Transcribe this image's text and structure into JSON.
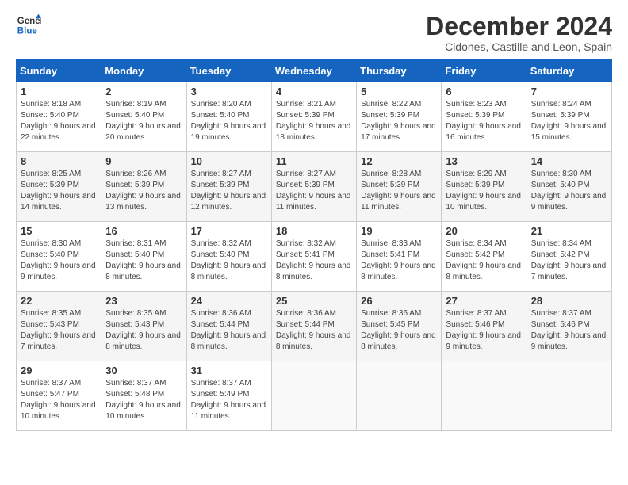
{
  "logo": {
    "line1": "General",
    "line2": "Blue"
  },
  "title": "December 2024",
  "subtitle": "Cidones, Castille and Leon, Spain",
  "weekdays": [
    "Sunday",
    "Monday",
    "Tuesday",
    "Wednesday",
    "Thursday",
    "Friday",
    "Saturday"
  ],
  "weeks": [
    [
      {
        "day": "1",
        "sunrise": "8:18 AM",
        "sunset": "5:40 PM",
        "daylight": "9 hours and 22 minutes."
      },
      {
        "day": "2",
        "sunrise": "8:19 AM",
        "sunset": "5:40 PM",
        "daylight": "9 hours and 20 minutes."
      },
      {
        "day": "3",
        "sunrise": "8:20 AM",
        "sunset": "5:40 PM",
        "daylight": "9 hours and 19 minutes."
      },
      {
        "day": "4",
        "sunrise": "8:21 AM",
        "sunset": "5:39 PM",
        "daylight": "9 hours and 18 minutes."
      },
      {
        "day": "5",
        "sunrise": "8:22 AM",
        "sunset": "5:39 PM",
        "daylight": "9 hours and 17 minutes."
      },
      {
        "day": "6",
        "sunrise": "8:23 AM",
        "sunset": "5:39 PM",
        "daylight": "9 hours and 16 minutes."
      },
      {
        "day": "7",
        "sunrise": "8:24 AM",
        "sunset": "5:39 PM",
        "daylight": "9 hours and 15 minutes."
      }
    ],
    [
      {
        "day": "8",
        "sunrise": "8:25 AM",
        "sunset": "5:39 PM",
        "daylight": "9 hours and 14 minutes."
      },
      {
        "day": "9",
        "sunrise": "8:26 AM",
        "sunset": "5:39 PM",
        "daylight": "9 hours and 13 minutes."
      },
      {
        "day": "10",
        "sunrise": "8:27 AM",
        "sunset": "5:39 PM",
        "daylight": "9 hours and 12 minutes."
      },
      {
        "day": "11",
        "sunrise": "8:27 AM",
        "sunset": "5:39 PM",
        "daylight": "9 hours and 11 minutes."
      },
      {
        "day": "12",
        "sunrise": "8:28 AM",
        "sunset": "5:39 PM",
        "daylight": "9 hours and 11 minutes."
      },
      {
        "day": "13",
        "sunrise": "8:29 AM",
        "sunset": "5:39 PM",
        "daylight": "9 hours and 10 minutes."
      },
      {
        "day": "14",
        "sunrise": "8:30 AM",
        "sunset": "5:40 PM",
        "daylight": "9 hours and 9 minutes."
      }
    ],
    [
      {
        "day": "15",
        "sunrise": "8:30 AM",
        "sunset": "5:40 PM",
        "daylight": "9 hours and 9 minutes."
      },
      {
        "day": "16",
        "sunrise": "8:31 AM",
        "sunset": "5:40 PM",
        "daylight": "9 hours and 8 minutes."
      },
      {
        "day": "17",
        "sunrise": "8:32 AM",
        "sunset": "5:40 PM",
        "daylight": "9 hours and 8 minutes."
      },
      {
        "day": "18",
        "sunrise": "8:32 AM",
        "sunset": "5:41 PM",
        "daylight": "9 hours and 8 minutes."
      },
      {
        "day": "19",
        "sunrise": "8:33 AM",
        "sunset": "5:41 PM",
        "daylight": "9 hours and 8 minutes."
      },
      {
        "day": "20",
        "sunrise": "8:34 AM",
        "sunset": "5:42 PM",
        "daylight": "9 hours and 8 minutes."
      },
      {
        "day": "21",
        "sunrise": "8:34 AM",
        "sunset": "5:42 PM",
        "daylight": "9 hours and 7 minutes."
      }
    ],
    [
      {
        "day": "22",
        "sunrise": "8:35 AM",
        "sunset": "5:43 PM",
        "daylight": "9 hours and 7 minutes."
      },
      {
        "day": "23",
        "sunrise": "8:35 AM",
        "sunset": "5:43 PM",
        "daylight": "9 hours and 8 minutes."
      },
      {
        "day": "24",
        "sunrise": "8:36 AM",
        "sunset": "5:44 PM",
        "daylight": "9 hours and 8 minutes."
      },
      {
        "day": "25",
        "sunrise": "8:36 AM",
        "sunset": "5:44 PM",
        "daylight": "9 hours and 8 minutes."
      },
      {
        "day": "26",
        "sunrise": "8:36 AM",
        "sunset": "5:45 PM",
        "daylight": "9 hours and 8 minutes."
      },
      {
        "day": "27",
        "sunrise": "8:37 AM",
        "sunset": "5:46 PM",
        "daylight": "9 hours and 9 minutes."
      },
      {
        "day": "28",
        "sunrise": "8:37 AM",
        "sunset": "5:46 PM",
        "daylight": "9 hours and 9 minutes."
      }
    ],
    [
      {
        "day": "29",
        "sunrise": "8:37 AM",
        "sunset": "5:47 PM",
        "daylight": "9 hours and 10 minutes."
      },
      {
        "day": "30",
        "sunrise": "8:37 AM",
        "sunset": "5:48 PM",
        "daylight": "9 hours and 10 minutes."
      },
      {
        "day": "31",
        "sunrise": "8:37 AM",
        "sunset": "5:49 PM",
        "daylight": "9 hours and 11 minutes."
      },
      null,
      null,
      null,
      null
    ]
  ]
}
